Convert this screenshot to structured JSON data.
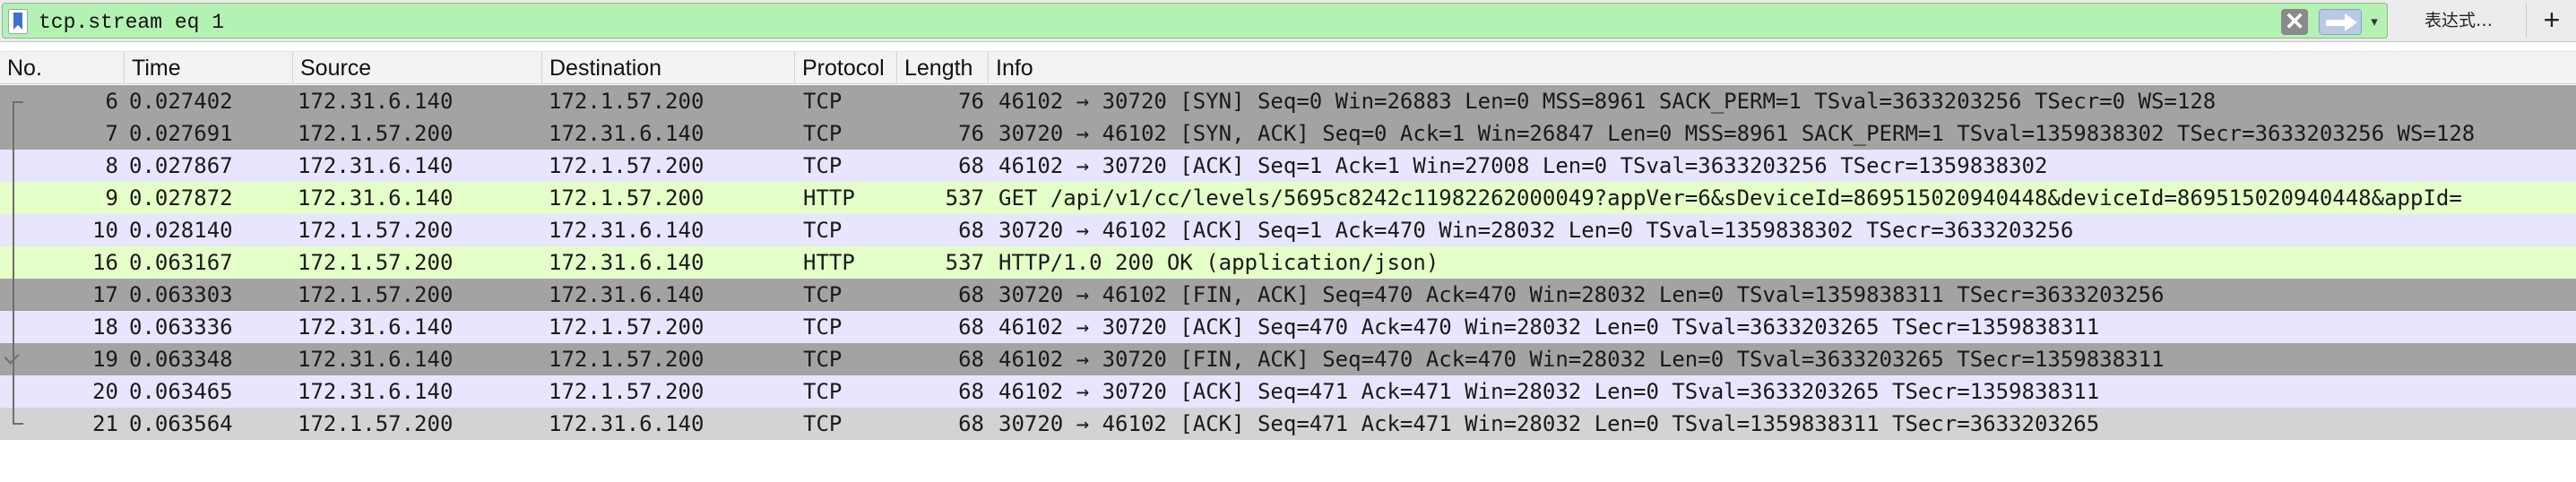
{
  "filter": {
    "text": "tcp.stream eq 1",
    "clear_label": "✕",
    "expression_label": "表达式…",
    "add_label": "+",
    "dropdown_glyph": "▾"
  },
  "columns": {
    "no": "No.",
    "time": "Time",
    "source": "Source",
    "destination": "Destination",
    "protocol": "Protocol",
    "length": "Length",
    "info": "Info"
  },
  "colors": {
    "tcp_gray": "#a0a0a0",
    "tcp_lavender": "#e7e6fe",
    "http_green": "#e4ffc7",
    "fin_dark": "#a0a0a0",
    "last_gray": "#d6d6d6"
  },
  "rows": [
    {
      "no": "6",
      "time": "0.027402",
      "source": "172.31.6.140",
      "destination": "172.1.57.200",
      "protocol": "TCP",
      "length": "76",
      "info": "46102 → 30720 [SYN] Seq=0 Win=26883 Len=0 MSS=8961 SACK_PERM=1 TSval=3633203256 TSecr=0 WS=128",
      "bg": "#a3a3a3"
    },
    {
      "no": "7",
      "time": "0.027691",
      "source": "172.1.57.200",
      "destination": "172.31.6.140",
      "protocol": "TCP",
      "length": "76",
      "info": "30720 → 46102 [SYN, ACK] Seq=0 Ack=1 Win=26847 Len=0 MSS=8961 SACK_PERM=1 TSval=1359838302 TSecr=3633203256 WS=128",
      "bg": "#a3a3a3"
    },
    {
      "no": "8",
      "time": "0.027867",
      "source": "172.31.6.140",
      "destination": "172.1.57.200",
      "protocol": "TCP",
      "length": "68",
      "info": "46102 → 30720 [ACK] Seq=1 Ack=1 Win=27008 Len=0 TSval=3633203256 TSecr=1359838302",
      "bg": "#e7e6fe"
    },
    {
      "no": "9",
      "time": "0.027872",
      "source": "172.31.6.140",
      "destination": "172.1.57.200",
      "protocol": "HTTP",
      "length": "537",
      "info": "GET /api/v1/cc/levels/5695c8242c11982262000049?appVer=6&sDeviceId=869515020940448&deviceId=869515020940448&appId=",
      "bg": "#e4ffc7"
    },
    {
      "no": "10",
      "time": "0.028140",
      "source": "172.1.57.200",
      "destination": "172.31.6.140",
      "protocol": "TCP",
      "length": "68",
      "info": "30720 → 46102 [ACK] Seq=1 Ack=470 Win=28032 Len=0 TSval=1359838302 TSecr=3633203256",
      "bg": "#e7e6fe"
    },
    {
      "no": "16",
      "time": "0.063167",
      "source": "172.1.57.200",
      "destination": "172.31.6.140",
      "protocol": "HTTP",
      "length": "537",
      "info": "HTTP/1.0 200 OK  (application/json)",
      "bg": "#e4ffc7"
    },
    {
      "no": "17",
      "time": "0.063303",
      "source": "172.1.57.200",
      "destination": "172.31.6.140",
      "protocol": "TCP",
      "length": "68",
      "info": "30720 → 46102 [FIN, ACK] Seq=470 Ack=470 Win=28032 Len=0 TSval=1359838311 TSecr=3633203256",
      "bg": "#a3a3a3"
    },
    {
      "no": "18",
      "time": "0.063336",
      "source": "172.31.6.140",
      "destination": "172.1.57.200",
      "protocol": "TCP",
      "length": "68",
      "info": "46102 → 30720 [ACK] Seq=470 Ack=470 Win=28032 Len=0 TSval=3633203265 TSecr=1359838311",
      "bg": "#e7e6fe"
    },
    {
      "no": "19",
      "time": "0.063348",
      "source": "172.31.6.140",
      "destination": "172.1.57.200",
      "protocol": "TCP",
      "length": "68",
      "info": "46102 → 30720 [FIN, ACK] Seq=470 Ack=470 Win=28032 Len=0 TSval=3633203265 TSecr=1359838311",
      "bg": "#a3a3a3"
    },
    {
      "no": "20",
      "time": "0.063465",
      "source": "172.31.6.140",
      "destination": "172.1.57.200",
      "protocol": "TCP",
      "length": "68",
      "info": "46102 → 30720 [ACK] Seq=471 Ack=471 Win=28032 Len=0 TSval=3633203265 TSecr=1359838311",
      "bg": "#e7e6fe"
    },
    {
      "no": "21",
      "time": "0.063564",
      "source": "172.1.57.200",
      "destination": "172.31.6.140",
      "protocol": "TCP",
      "length": "68",
      "info": "30720 → 46102 [ACK] Seq=471 Ack=471 Win=28032 Len=0 TSval=1359838311 TSecr=3633203265",
      "bg": "#d3d3d3"
    }
  ]
}
